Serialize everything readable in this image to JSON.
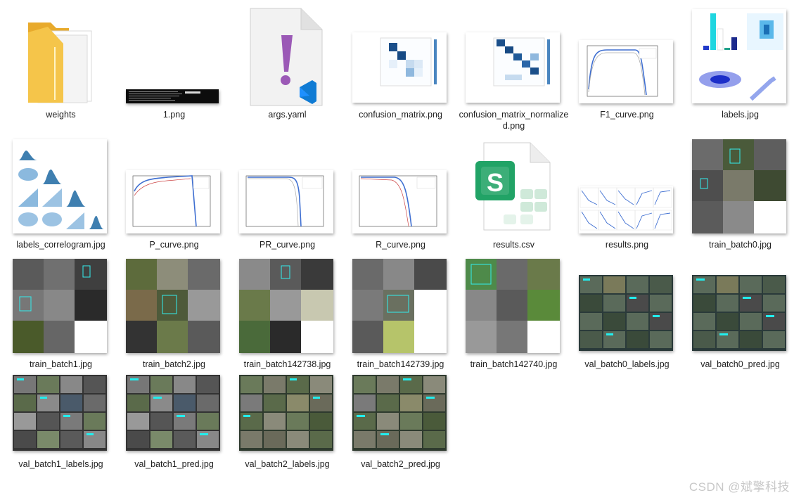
{
  "files": [
    {
      "name": "weights",
      "kind": "folder"
    },
    {
      "name": "1.png",
      "kind": "terminal"
    },
    {
      "name": "args.yaml",
      "kind": "yaml"
    },
    {
      "name": "confusion_matrix.png",
      "kind": "matrix"
    },
    {
      "name": "confusion_matrix_normalized.png",
      "kind": "matrix"
    },
    {
      "name": "F1_curve.png",
      "kind": "curve"
    },
    {
      "name": "labels.jpg",
      "kind": "labels"
    },
    {
      "name": "labels_correlogram.jpg",
      "kind": "correlogram"
    },
    {
      "name": "P_curve.png",
      "kind": "curve"
    },
    {
      "name": "PR_curve.png",
      "kind": "curve"
    },
    {
      "name": "R_curve.png",
      "kind": "curve"
    },
    {
      "name": "results.csv",
      "kind": "csv"
    },
    {
      "name": "results.png",
      "kind": "results"
    },
    {
      "name": "train_batch0.jpg",
      "kind": "batch"
    },
    {
      "name": "train_batch1.jpg",
      "kind": "batch"
    },
    {
      "name": "train_batch2.jpg",
      "kind": "batch"
    },
    {
      "name": "train_batch142738.jpg",
      "kind": "batch"
    },
    {
      "name": "train_batch142739.jpg",
      "kind": "batch"
    },
    {
      "name": "train_batch142740.jpg",
      "kind": "batch"
    },
    {
      "name": "val_batch0_labels.jpg",
      "kind": "val"
    },
    {
      "name": "val_batch0_pred.jpg",
      "kind": "val"
    },
    {
      "name": "val_batch1_labels.jpg",
      "kind": "val"
    },
    {
      "name": "val_batch1_pred.jpg",
      "kind": "val"
    },
    {
      "name": "val_batch2_labels.jpg",
      "kind": "val"
    },
    {
      "name": "val_batch2_pred.jpg",
      "kind": "val"
    }
  ],
  "watermark": "CSDN @斌擎科技",
  "colors": {
    "folder": "#f5c54a",
    "yaml_mark": "#9b59b6",
    "vscode": "#0f7bd4",
    "sheets": "#21a366",
    "matrix": "#1b4f8a",
    "curve": "#3f6fd1"
  }
}
